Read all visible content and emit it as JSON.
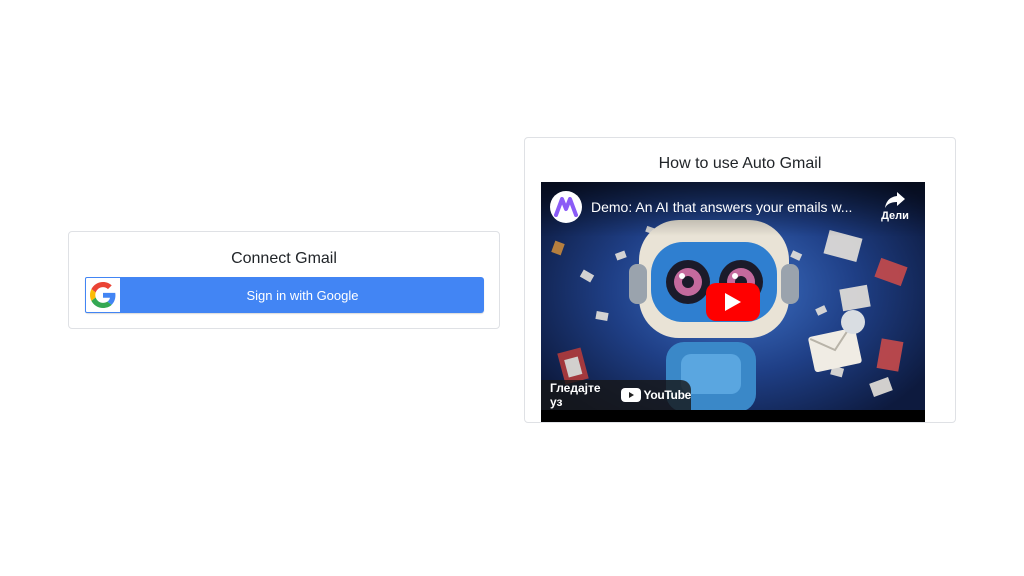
{
  "connect": {
    "title": "Connect Gmail",
    "google_button_label": "Sign in with Google"
  },
  "howto": {
    "title": "How to use Auto Gmail",
    "video": {
      "title": "Demo: An AI that answers your emails w...",
      "share_label": "Дели",
      "watch_on_label": "Гледајте уз",
      "youtube_label": "YouTube"
    }
  },
  "colors": {
    "google_blue": "#4285f4",
    "youtube_red": "#ff0000"
  },
  "icons": [
    "google-logo-icon",
    "channel-logo-icon",
    "share-icon",
    "play-icon",
    "youtube-logo-icon"
  ]
}
